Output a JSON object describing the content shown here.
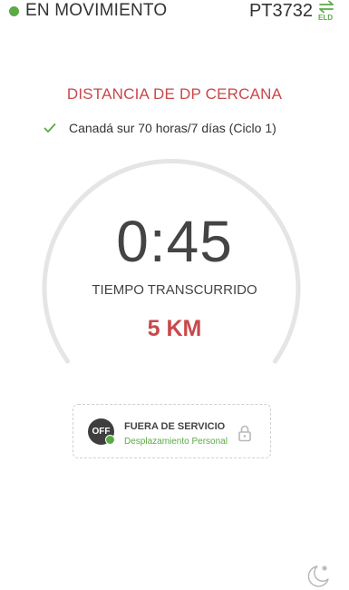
{
  "status": {
    "state_label": "EN MOVIMIENTO",
    "vehicle_id": "PT3732",
    "eld_label": "ELD"
  },
  "main": {
    "section_title": "DISTANCIA DE DP CERCANA",
    "cycle_label": "Canadá sur 70 horas/7 días (Ciclo 1)",
    "elapsed_time": "0:45",
    "elapsed_label": "TIEMPO TRANSCURRIDO",
    "distance": "5 KM"
  },
  "duty": {
    "badge": "OFF",
    "title": "FUERA DE SERVICIO",
    "subtitle": "Desplazamiento Personal"
  },
  "colors": {
    "accent_red": "#c9484b",
    "accent_green": "#5aaa46"
  },
  "icons": {
    "status": "green-dot-icon",
    "eld": "swap-arrows-icon",
    "cycle": "checkmark-icon",
    "lock": "lock-icon",
    "night": "moon-icon"
  }
}
